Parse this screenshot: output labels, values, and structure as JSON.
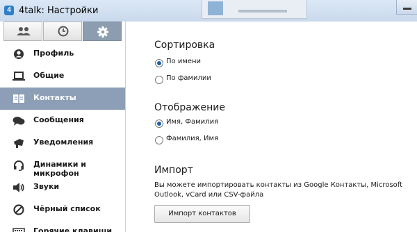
{
  "window": {
    "title": "4talk: Настройки",
    "app_icon": "4"
  },
  "tabs": [
    {
      "icon": "contacts-icon"
    },
    {
      "icon": "clock-icon"
    },
    {
      "icon": "gear-icon",
      "active": true
    }
  ],
  "sidebar": {
    "items": [
      {
        "label": "Профиль",
        "icon": "profile-icon"
      },
      {
        "label": "Общие",
        "icon": "laptop-icon"
      },
      {
        "label": "Контакты",
        "icon": "address-book-icon",
        "active": true
      },
      {
        "label": "Сообщения",
        "icon": "chat-icon"
      },
      {
        "label": "Уведомления",
        "icon": "megaphone-icon"
      },
      {
        "label": "Динамики и микрофон",
        "icon": "headset-icon"
      },
      {
        "label": "Звуки",
        "icon": "speaker-icon"
      },
      {
        "label": "Чёрный список",
        "icon": "block-icon"
      },
      {
        "label": "Горячие клавиши",
        "icon": "keyboard-icon"
      }
    ]
  },
  "main": {
    "sorting": {
      "title": "Сортировка",
      "options": [
        {
          "label": "По имени",
          "checked": true
        },
        {
          "label": "По фамилии",
          "checked": false
        }
      ]
    },
    "display": {
      "title": "Отображение",
      "options": [
        {
          "label": "Имя, Фамилия",
          "checked": true
        },
        {
          "label": "Фамилия, Имя",
          "checked": false
        }
      ]
    },
    "import": {
      "title": "Импорт",
      "description": "Вы можете импортировать контакты из Google Контакты, Microsoft Outlook, vCard или CSV-файла",
      "button_label": "Импорт контактов"
    }
  },
  "colors": {
    "active_nav": "#8d9fb6",
    "active_tab": "#8d9db0",
    "radio_dot": "#1d5fa8"
  }
}
